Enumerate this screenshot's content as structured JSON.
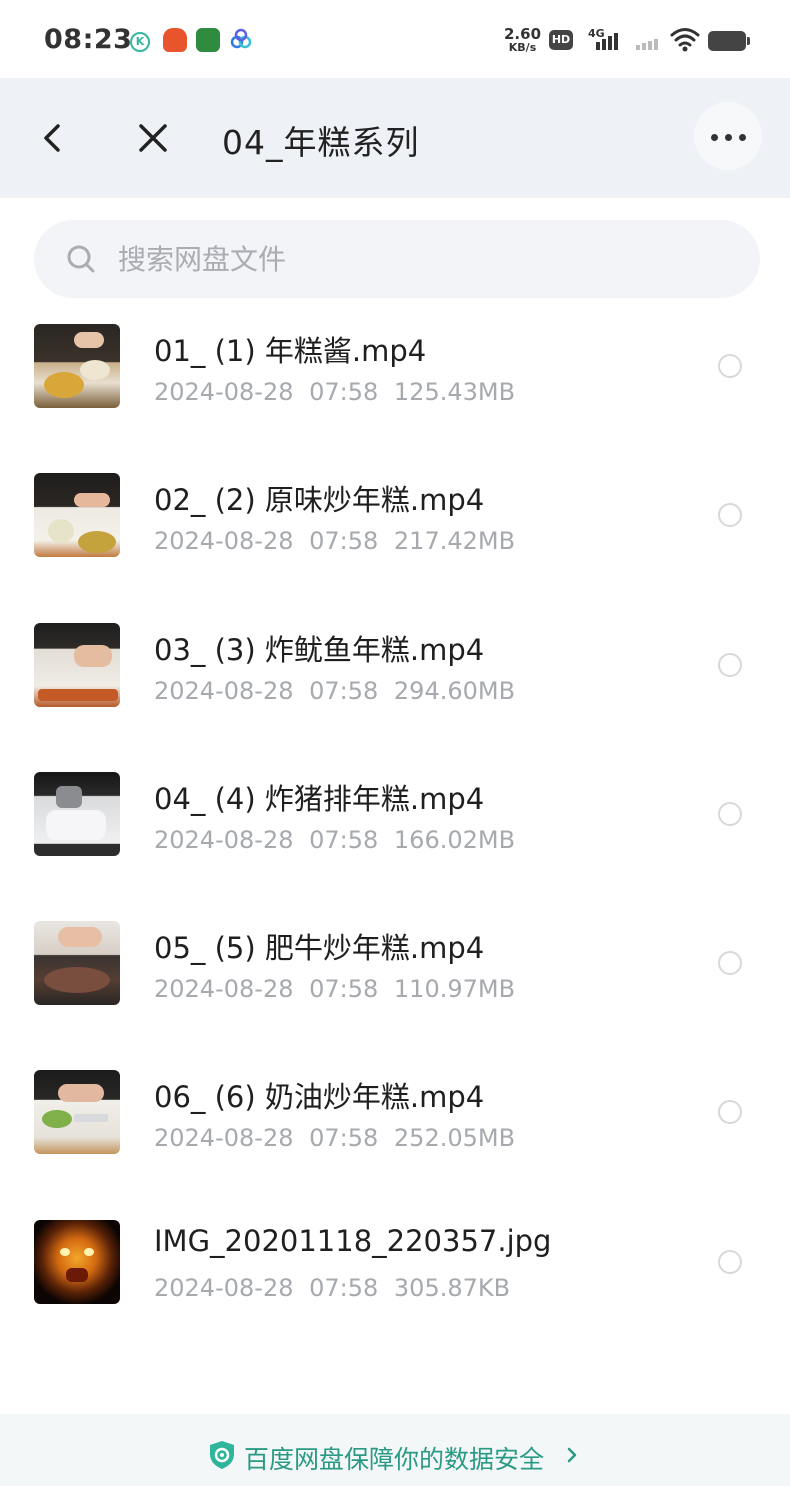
{
  "status_bar": {
    "time": "08:23",
    "net_speed_value": "2.60",
    "net_speed_unit": "KB/s",
    "hd_label": "HD",
    "network_label": "4G",
    "app_icons": [
      "kuan-icon",
      "fox-app-icon",
      "game-app-icon",
      "cloud-app-icon"
    ]
  },
  "header": {
    "back_icon": "chevron-left-icon",
    "close_icon": "close-icon",
    "title": "04_年糕系列",
    "more_icon": "more-dots-icon"
  },
  "search": {
    "icon": "search-icon",
    "placeholder": "搜索网盘文件"
  },
  "files": [
    {
      "name": "01_ (1) 年糕酱.mp4",
      "meta": "2024-08-28  07:58  125.43MB",
      "thumb": "video-thumb",
      "selected": false
    },
    {
      "name": "02_ (2) 原味炒年糕.mp4",
      "meta": "2024-08-28  07:58  217.42MB",
      "thumb": "video-thumb",
      "selected": false
    },
    {
      "name": "03_ (3) 炸鱿鱼年糕.mp4",
      "meta": "2024-08-28  07:58  294.60MB",
      "thumb": "video-thumb",
      "selected": false
    },
    {
      "name": "04_ (4) 炸猪排年糕.mp4",
      "meta": "2024-08-28  07:58  166.02MB",
      "thumb": "video-thumb",
      "selected": false
    },
    {
      "name": "05_ (5) 肥牛炒年糕.mp4",
      "meta": "2024-08-28  07:58  110.97MB",
      "thumb": "video-thumb",
      "selected": false
    },
    {
      "name": "06_ (6) 奶油炒年糕.mp4",
      "meta": "2024-08-28  07:58  252.05MB",
      "thumb": "video-thumb",
      "selected": false
    },
    {
      "name": "IMG_20201118_220357.jpg",
      "meta": "2024-08-28  07:58  305.87KB",
      "thumb": "image-thumb",
      "selected": false
    }
  ],
  "footer": {
    "icon": "shield-icon",
    "text": "百度网盘保障你的数据安全",
    "arrow_icon": "chevron-right-icon"
  },
  "colors": {
    "header_bg": "#eef2f6",
    "accent_green": "#2a9a85",
    "meta_gray": "#a6a9ae"
  }
}
